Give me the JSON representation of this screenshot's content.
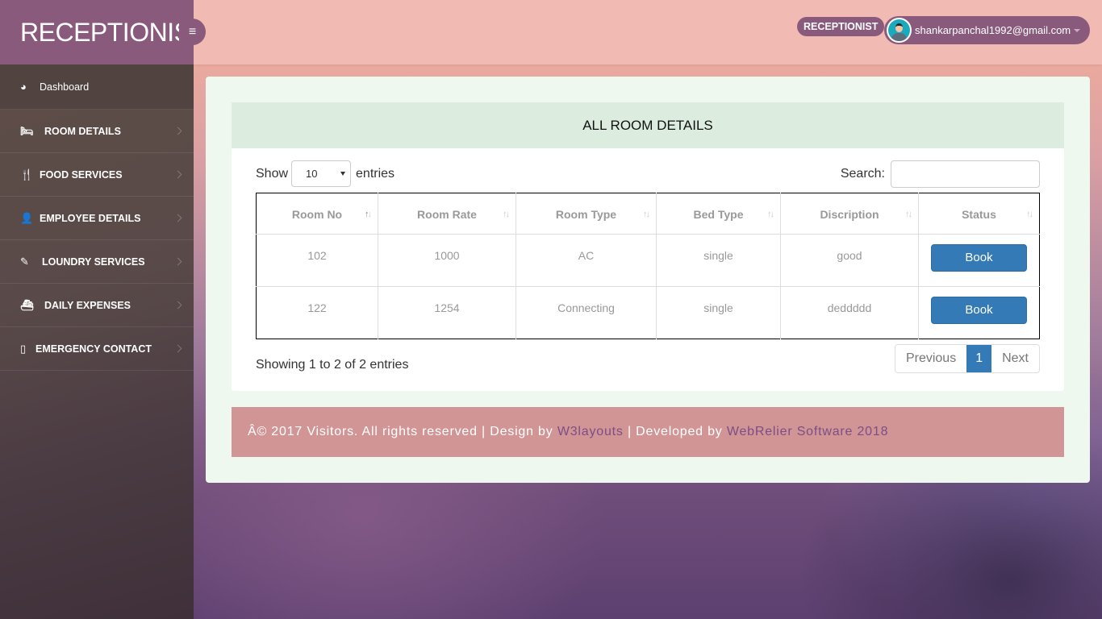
{
  "brand": {
    "title": "RECEPTIONIST",
    "menu_icon": "hamburger-icon"
  },
  "header": {
    "role_badge": "RECEPTIONIST",
    "user_email": "shankarpanchal1992@gmail.com",
    "avatar_icon": "user-avatar-icon",
    "dropdown_icon": "caret-down-icon"
  },
  "sidebar": {
    "items": [
      {
        "label": "Dashboard",
        "icon": "dashboard-icon",
        "glyph": "◕",
        "has_chevron": false
      },
      {
        "label": "ROOM DETAILS",
        "icon": "bed-icon",
        "glyph": "🛏",
        "has_chevron": true
      },
      {
        "label": "FOOD SERVICES",
        "icon": "cutlery-icon",
        "glyph": "🍴",
        "has_chevron": true
      },
      {
        "label": "EMPLOYEE DETAILS",
        "icon": "user-icon",
        "glyph": "👤",
        "has_chevron": true
      },
      {
        "label": "LOUNDRY SERVICES",
        "icon": "magic-wand-icon",
        "glyph": "✎",
        "has_chevron": true
      },
      {
        "label": "DAILY EXPENSES",
        "icon": "ship-icon",
        "glyph": "⛴",
        "has_chevron": true
      },
      {
        "label": "EMERGENCY CONTACT",
        "icon": "mobile-phone-icon",
        "glyph": "▯",
        "has_chevron": true
      }
    ]
  },
  "main": {
    "title": "ALL ROOM DETAILS",
    "show_label": "Show",
    "entries_label": "entries",
    "page_length": "10",
    "search_label": "Search:",
    "search_value": "",
    "table": {
      "columns": [
        "Room No",
        "Room Rate",
        "Room Type",
        "Bed Type",
        "Discription",
        "Status"
      ],
      "rows": [
        {
          "room_no": "102",
          "room_rate": "1000",
          "room_type": "AC",
          "bed_type": "single",
          "description": "good",
          "action": "Book"
        },
        {
          "room_no": "122",
          "room_rate": "1254",
          "room_type": "Connecting",
          "bed_type": "single",
          "description": "deddddd",
          "action": "Book"
        }
      ]
    },
    "info": "Showing 1 to 2 of 2 entries",
    "pagination": {
      "previous": "Previous",
      "current": "1",
      "next": "Next"
    }
  },
  "footer": {
    "text_before": "Â© 2017 Visitors. All rights reserved | Design by ",
    "link1": "W3layouts",
    "text_middle": " | Developed by ",
    "link2": "WebRelier Software 2018"
  },
  "colors": {
    "brand": "#8a5a7c",
    "topbar": "#f1bbb3",
    "primary_button": "#337ab7",
    "card_header": "#dcede0",
    "footer": "#d19596",
    "footer_link": "#7b4e85"
  }
}
